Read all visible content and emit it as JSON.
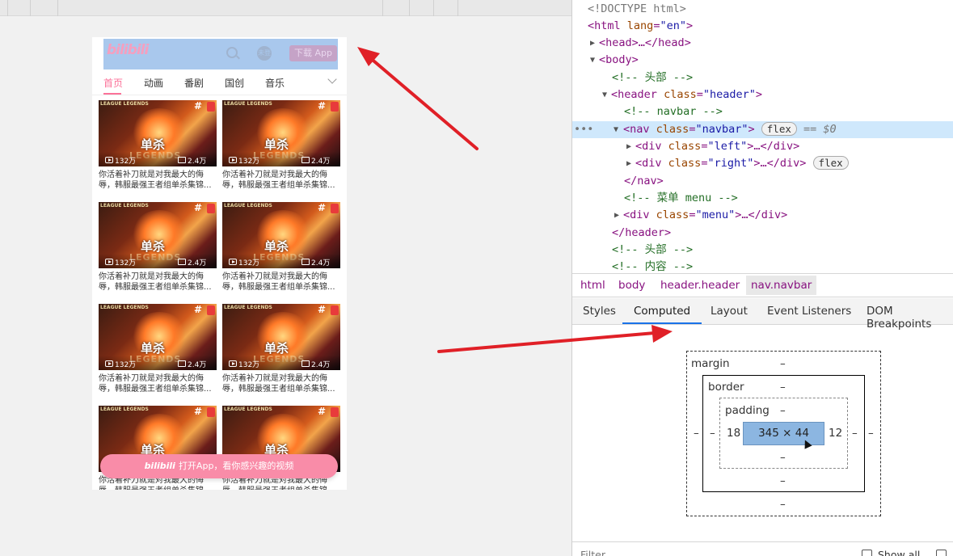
{
  "viewport": {
    "navbar": {
      "logo": "bilibili",
      "download_button": "下载 App",
      "avatar_text": "未登"
    },
    "menu": {
      "items": [
        "首页",
        "动画",
        "番剧",
        "国创",
        "音乐"
      ],
      "active_index": 0
    },
    "video_card": {
      "thumb_title": "单杀",
      "thumb_legend": "LEGENDS",
      "thumb_brand": "LEAGUE LEGENDS",
      "views": "132万",
      "danmaku": "2.4万",
      "description": "你活着补刀就是对我最大的侮辱，韩服最强王者组单杀集锦..."
    },
    "open_app_banner": {
      "logo": "bilibili",
      "text": "打开App，看你感兴趣的视频"
    }
  },
  "devtools": {
    "dom": {
      "doctype": "<!DOCTYPE html>",
      "html_tag": "html",
      "html_attr": "lang",
      "html_val": "\"en\"",
      "head": "head",
      "body": "body",
      "comment_header": "<!-- 头部 -->",
      "header_tag": "header",
      "header_class": "\"header\"",
      "comment_navbar": "<!-- navbar -->",
      "nav_tag": "nav",
      "nav_class": "\"navbar\"",
      "flex_badge": "flex",
      "selected_marker": "== $0",
      "div_left_class": "\"left\"",
      "div_right_class": "\"right\"",
      "comment_menu": "<!-- 菜单 menu -->",
      "div_menu_class": "\"menu\"",
      "comment_header2": "<!-- 头部 -->",
      "comment_content": "<!-- 内容 -->"
    },
    "breadcrumbs": [
      "html",
      "body",
      "header.header",
      "nav.navbar"
    ],
    "tabs": [
      "Styles",
      "Computed",
      "Layout",
      "Event Listeners",
      "DOM Breakpoints"
    ],
    "active_tab": "Computed",
    "box_model": {
      "margin_label": "margin",
      "border_label": "border",
      "padding_label": "padding",
      "dash": "–",
      "content_size": "345 × 44",
      "padding_left": "18",
      "padding_right": "12"
    },
    "filter": {
      "placeholder": "Filter",
      "show_all": "Show all"
    }
  },
  "colors": {
    "bilibili_pink": "#fb7299",
    "selection_blue": "#a9c8ed",
    "arrow_red": "#e02027"
  }
}
